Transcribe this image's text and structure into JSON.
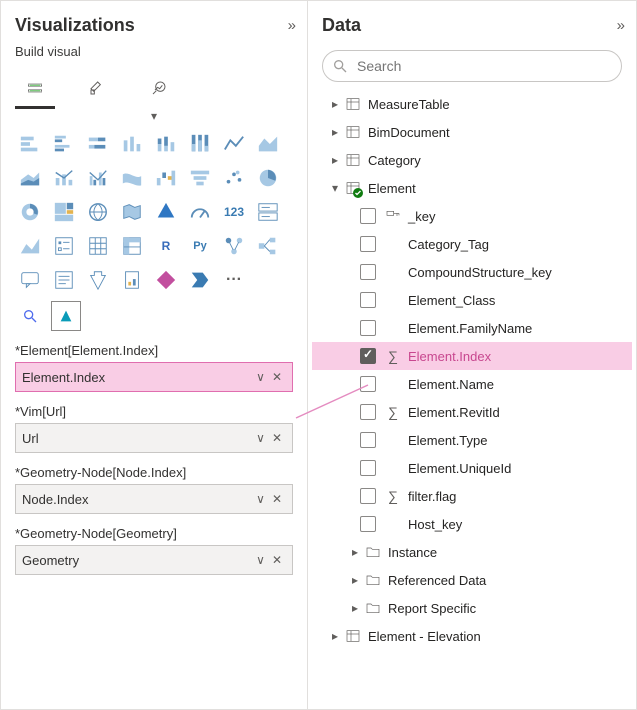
{
  "viz_pane": {
    "title": "Visualizations",
    "sub_title": "Build visual",
    "tabs": [
      "build",
      "format",
      "analytics"
    ],
    "wells": [
      {
        "label": "*Element[Element.Index]",
        "value": "Element.Index",
        "highlight": true
      },
      {
        "label": "*Vim[Url]",
        "value": "Url",
        "highlight": false
      },
      {
        "label": "*Geometry-Node[Node.Index]",
        "value": "Node.Index",
        "highlight": false
      },
      {
        "label": "*Geometry-Node[Geometry]",
        "value": "Geometry",
        "highlight": false
      }
    ],
    "chart_icons": [
      "stacked-bar",
      "clustered-bar",
      "stacked-100-bar",
      "clustered-column",
      "stacked-column",
      "stacked-100-column",
      "line",
      "area",
      "stacked-area",
      "line-col",
      "line-col-stacked",
      "ribbon",
      "waterfall",
      "funnel",
      "scatter",
      "pie",
      "donut",
      "treemap",
      "map",
      "filled-map",
      "azure-map",
      "gauge",
      "card",
      "card-multi",
      "kpi",
      "slicer",
      "table",
      "matrix",
      "r",
      "python",
      "key-influencers",
      "decomp-tree",
      "qna",
      "smart-narrative",
      "metrics",
      "paginated",
      "power-apps",
      "power-automate",
      "arcgis",
      "more"
    ]
  },
  "data_pane": {
    "title": "Data",
    "search_placeholder": "Search",
    "tables": [
      {
        "name": "MeasureTable",
        "icon": "table",
        "expanded": false
      },
      {
        "name": "BimDocument",
        "icon": "table",
        "expanded": false
      },
      {
        "name": "Category",
        "icon": "table",
        "expanded": false
      },
      {
        "name": "Element",
        "icon": "table",
        "expanded": true,
        "badge": true,
        "fields": [
          {
            "name": "_key",
            "checked": false,
            "measure": false,
            "key": true
          },
          {
            "name": "Category_Tag",
            "checked": false,
            "measure": false
          },
          {
            "name": "CompoundStructure_key",
            "checked": false,
            "measure": false
          },
          {
            "name": "Element_Class",
            "checked": false,
            "measure": false
          },
          {
            "name": "Element.FamilyName",
            "checked": false,
            "measure": false
          },
          {
            "name": "Element.Index",
            "checked": true,
            "measure": true,
            "highlight": true
          },
          {
            "name": "Element.Name",
            "checked": false,
            "measure": false
          },
          {
            "name": "Element.RevitId",
            "checked": false,
            "measure": true
          },
          {
            "name": "Element.Type",
            "checked": false,
            "measure": false
          },
          {
            "name": "Element.UniqueId",
            "checked": false,
            "measure": false
          },
          {
            "name": "filter.flag",
            "checked": false,
            "measure": true
          },
          {
            "name": "Host_key",
            "checked": false,
            "measure": false
          }
        ],
        "subfolders": [
          {
            "name": "Instance"
          },
          {
            "name": "Referenced Data"
          },
          {
            "name": "Report Specific"
          }
        ]
      },
      {
        "name": "Element - Elevation",
        "icon": "table",
        "expanded": false
      }
    ]
  }
}
